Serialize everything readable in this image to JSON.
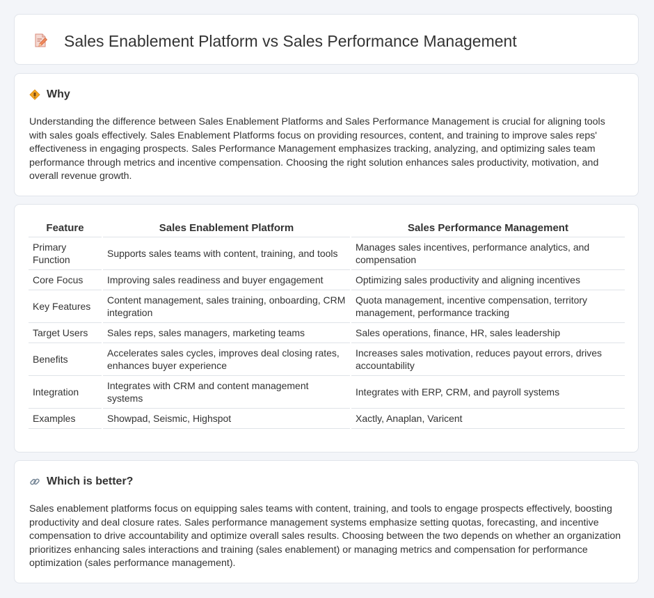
{
  "header": {
    "title": "Sales Enablement Platform vs Sales Performance Management",
    "icon": "document-pencil-icon"
  },
  "why": {
    "title": "Why",
    "icon": "diamond-sign-icon",
    "text": "Understanding the difference between Sales Enablement Platforms and Sales Performance Management is crucial for aligning tools with sales goals effectively. Sales Enablement Platforms focus on providing resources, content, and training to improve sales reps' effectiveness in engaging prospects. Sales Performance Management emphasizes tracking, analyzing, and optimizing sales team performance through metrics and incentive compensation. Choosing the right solution enhances sales productivity, motivation, and overall revenue growth."
  },
  "comparison": {
    "headers": [
      "Feature",
      "Sales Enablement Platform",
      "Sales Performance Management"
    ],
    "rows": [
      [
        "Primary Function",
        "Supports sales teams with content, training, and tools",
        "Manages sales incentives, performance analytics, and compensation"
      ],
      [
        "Core Focus",
        "Improving sales readiness and buyer engagement",
        "Optimizing sales productivity and aligning incentives"
      ],
      [
        "Key Features",
        "Content management, sales training, onboarding, CRM integration",
        "Quota management, incentive compensation, territory management, performance tracking"
      ],
      [
        "Target Users",
        "Sales reps, sales managers, marketing teams",
        "Sales operations, finance, HR, sales leadership"
      ],
      [
        "Benefits",
        "Accelerates sales cycles, improves deal closing rates, enhances buyer experience",
        "Increases sales motivation, reduces payout errors, drives accountability"
      ],
      [
        "Integration",
        "Integrates with CRM and content management systems",
        "Integrates with ERP, CRM, and payroll systems"
      ],
      [
        "Examples",
        "Showpad, Seismic, Highspot",
        "Xactly, Anaplan, Varicent"
      ]
    ]
  },
  "better": {
    "title": "Which is better?",
    "icon": "link-icon",
    "text": "Sales enablement platforms focus on equipping sales teams with content, training, and tools to engage prospects effectively, boosting productivity and deal closure rates. Sales performance management systems emphasize setting quotas, forecasting, and incentive compensation to drive accountability and optimize overall sales results. Choosing between the two depends on whether an organization prioritizes enhancing sales interactions and training (sales enablement) or managing metrics and compensation for performance optimization (sales performance management)."
  }
}
